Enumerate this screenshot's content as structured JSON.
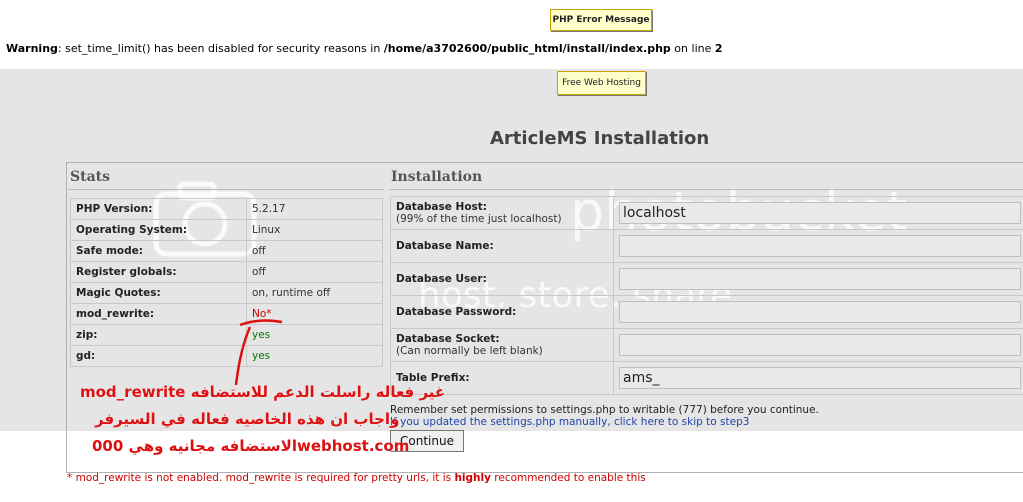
{
  "top_badge": "PHP Error Message",
  "warning": {
    "label": "Warning",
    "pre": ": set_time_limit() has been disabled for security reasons in ",
    "path": "/home/a3702600/public_html/install/index.php",
    "mid": " on line ",
    "line": "2"
  },
  "host_badge": "Free Web Hosting",
  "title": "ArticleMS Installation",
  "stats": {
    "heading": "Stats",
    "rows": [
      {
        "key": "PHP Version:",
        "value": "5.2.17"
      },
      {
        "key": "Operating System:",
        "value": "Linux"
      },
      {
        "key": "Safe mode:",
        "value": "off"
      },
      {
        "key": "Register globals:",
        "value": "off"
      },
      {
        "key": "Magic Quotes:",
        "value": "on, runtime off"
      },
      {
        "key": "mod_rewrite:",
        "value": "No*"
      },
      {
        "key": "zip:",
        "value": "yes"
      },
      {
        "key": "gd:",
        "value": "yes"
      }
    ]
  },
  "installation": {
    "heading": "Installation",
    "fields": [
      {
        "label": "Database Host:",
        "hint": "(99% of the time just localhost)",
        "value": "localhost"
      },
      {
        "label": "Database Name:",
        "hint": "",
        "value": ""
      },
      {
        "label": "Database User:",
        "hint": "",
        "value": ""
      },
      {
        "label": "Database Password:",
        "hint": "",
        "value": ""
      },
      {
        "label": "Database Socket:",
        "hint": "(Can normally be left blank)",
        "value": ""
      },
      {
        "label": "Table Prefix:",
        "hint": "",
        "value": "ams_"
      }
    ],
    "notice": "Remember set permissions to settings.php to writable (777) before you continue.",
    "skip_link": "If you updated the settings.php manually, click here to skip to step3",
    "continue_label": "Continue"
  },
  "footnote": {
    "pre": "* mod_rewrite is not enabled. mod_rewrite is required for pretty urls, it is ",
    "strong": "highly",
    "post": " recommended to enable this"
  },
  "annotation": {
    "line1": "mod_rewrite غير فعاله راسلت الدعم للاستضافه",
    "line2": "واجاب ان هذه الخاصيه فعاله في السيرفر",
    "line3": "الاستضافه مجانيه وهي 000webhost.com"
  },
  "watermark": {
    "line1": "photobucket",
    "line2": "host. store. share."
  },
  "colors": {
    "gray_background": "#e5e5e5",
    "badge_background": "#ffffcc",
    "status_no": "#cc0000",
    "status_yes": "#007700",
    "annotation": "#dd1111"
  }
}
